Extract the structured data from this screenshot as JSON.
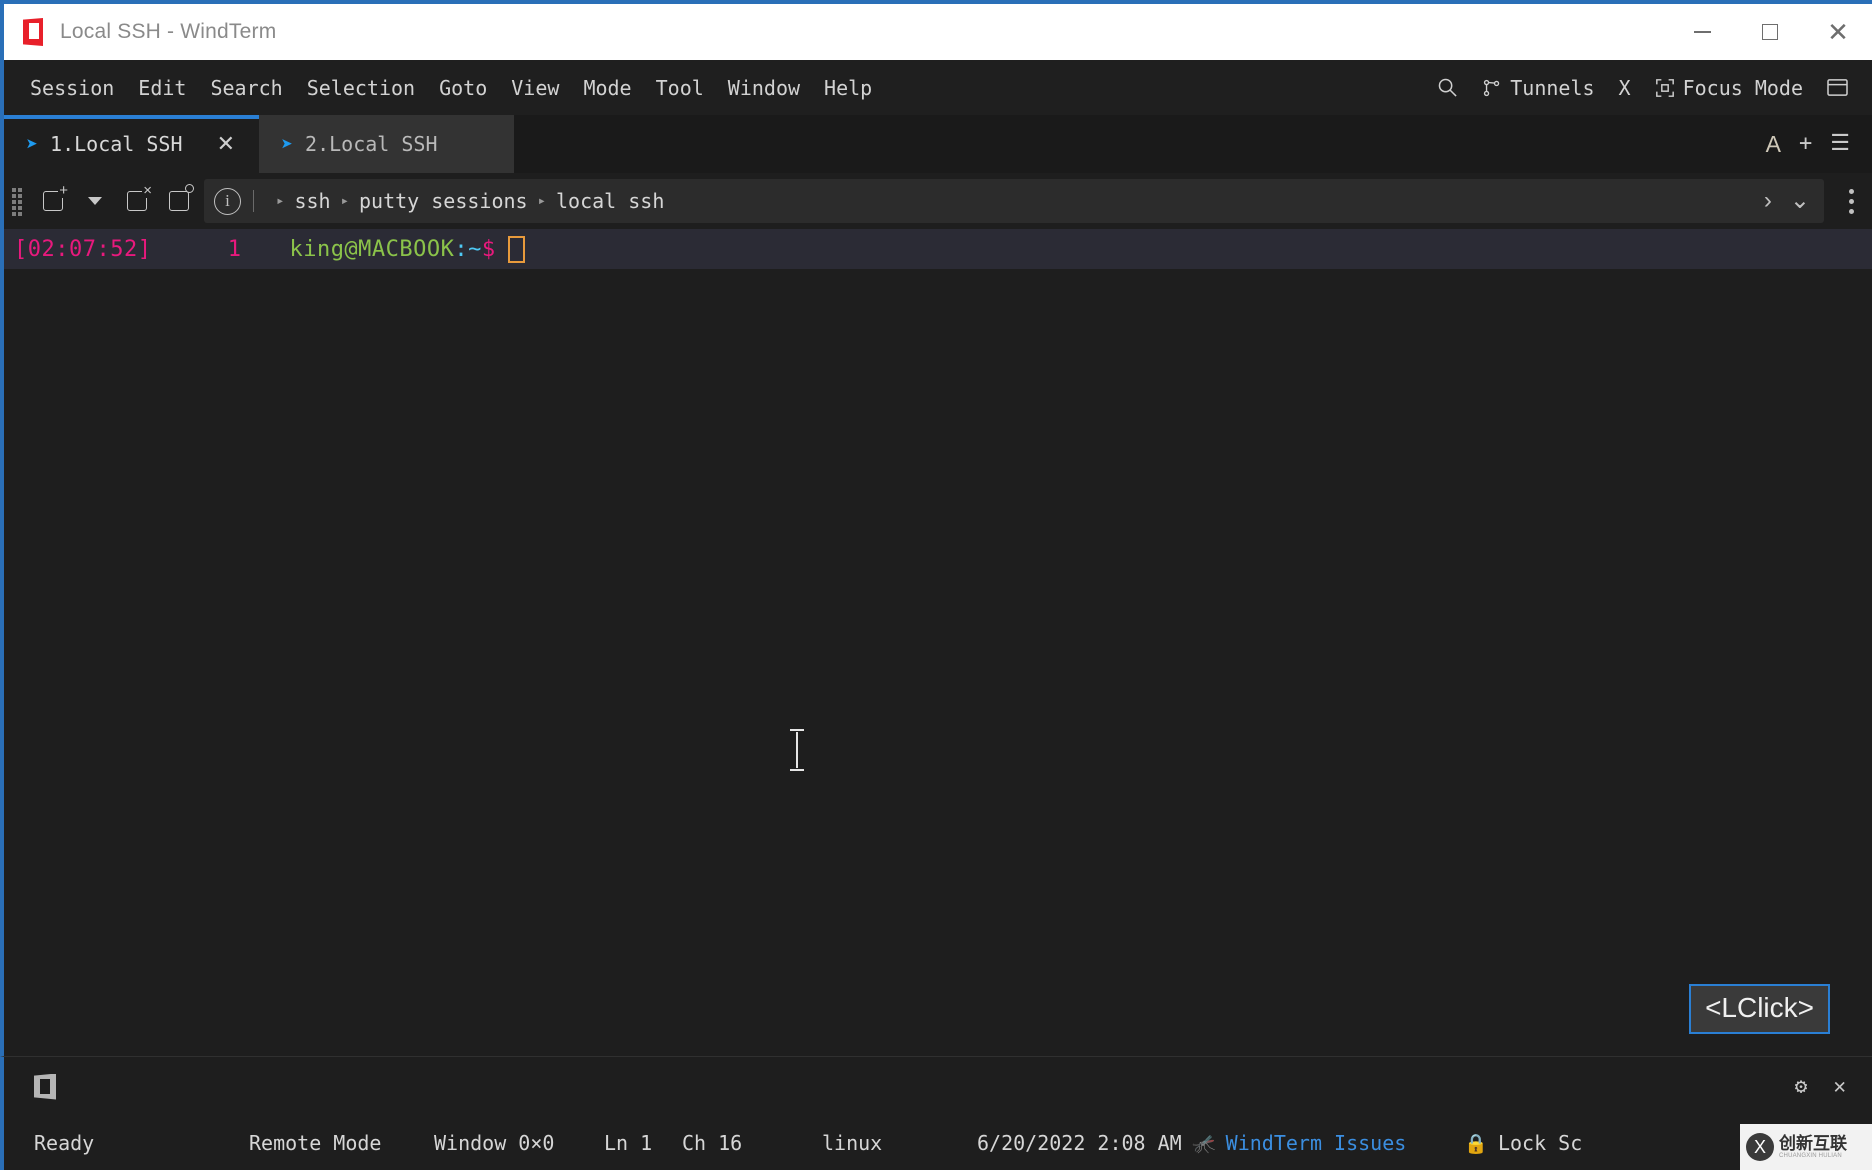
{
  "window": {
    "title": "Local SSH - WindTerm",
    "logo_icon": "windterm-logo-icon",
    "minimize_label": "—",
    "maximize_label": "□",
    "close_label": "✕"
  },
  "menubar": {
    "items": [
      {
        "label": "Session"
      },
      {
        "label": "Edit"
      },
      {
        "label": "Search"
      },
      {
        "label": "Selection"
      },
      {
        "label": "Goto"
      },
      {
        "label": "View"
      },
      {
        "label": "Mode"
      },
      {
        "label": "Tool"
      },
      {
        "label": "Window"
      },
      {
        "label": "Help"
      }
    ],
    "right": {
      "search_icon": "search-icon",
      "tunnels_icon": "tunnels-icon",
      "tunnels_label": "Tunnels",
      "x_label": "X",
      "focus_icon": "focus-mode-icon",
      "focus_label": "Focus Mode",
      "layout_icon": "layout-panel-icon"
    }
  },
  "tabs": {
    "items": [
      {
        "label": "1.Local SSH",
        "icon": "send-arrow-icon",
        "active": true,
        "close": "✕"
      },
      {
        "label": "2.Local SSH",
        "icon": "send-arrow-icon",
        "active": false
      }
    ],
    "right": {
      "font_label": "A",
      "add_label": "+",
      "menu_label": "☰"
    }
  },
  "toolbar": {
    "grip_icon": "drag-grip-icon",
    "new_session_icon": "new-session-icon",
    "dropdown_icon": "chevron-down-icon",
    "close_session_icon": "close-session-icon",
    "reconnect_icon": "reconnect-session-icon",
    "info_icon": "info-icon",
    "info_glyph": "i",
    "breadcrumb": {
      "separator": "▸",
      "items": [
        "ssh",
        "putty sessions",
        "local ssh"
      ]
    },
    "forward_icon": "chevron-right-icon",
    "expand_icon": "chevron-down-icon",
    "more_icon": "more-vertical-icon"
  },
  "terminal": {
    "timestamp": "[02:07:52]",
    "line_number": "1",
    "prompt_user": "king@MACBOOK",
    "prompt_colon": ":",
    "prompt_path": "~",
    "prompt_symbol": "$",
    "command": "",
    "cursor_color": "#e89a3c",
    "overlay_badge": "<LClick>",
    "overlay_badge_border": "#2a7fd4",
    "mouse_cursor_icon": "text-ibeam-cursor"
  },
  "bottom_panel": {
    "logo_icon": "windterm-mark-icon",
    "settings_icon": "gear-icon",
    "close_icon": "close-icon"
  },
  "statusbar": {
    "ready": "Ready",
    "mode": "Remote Mode",
    "window_size": "Window 0×0",
    "line": "Ln 1",
    "char": "Ch 16",
    "term_type": "linux",
    "datetime": "6/20/2022 2:08 AM",
    "issues_icon": "bug-icon",
    "issues_label": "WindTerm Issues",
    "issues_color": "#3b8ee0",
    "lock_icon": "lock-icon",
    "lock_label": "Lock Sc"
  },
  "watermark": {
    "logo_label": "X",
    "text_cn": "创新互联",
    "text_en": "CHUANGXIN HULIAN"
  }
}
